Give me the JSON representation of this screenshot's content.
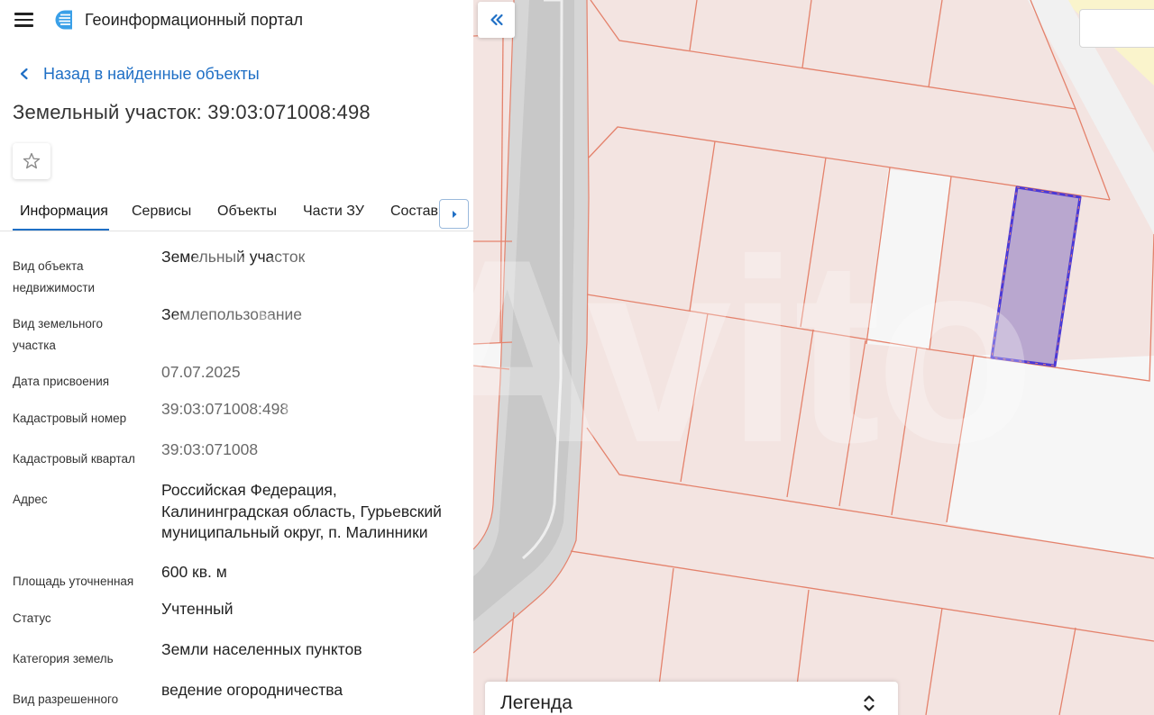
{
  "header": {
    "title": "Геоинформационный портал"
  },
  "nav": {
    "back_label": "Назад в найденные объекты"
  },
  "object": {
    "title": "Земельный участок: 39:03:071008:498"
  },
  "tabs": [
    {
      "label": "Информация",
      "active": true
    },
    {
      "label": "Сервисы"
    },
    {
      "label": "Объекты"
    },
    {
      "label": "Части ЗУ"
    },
    {
      "label": "Состав"
    }
  ],
  "info": [
    {
      "label": "Вид объекта недвижимости",
      "value": "Земельный участок"
    },
    {
      "label": "Вид земельного участка",
      "value": "Землепользование"
    },
    {
      "label": "Дата присвоения",
      "value": "07.07.2025"
    },
    {
      "label": "Кадастровый номер",
      "value": "39:03:071008:498"
    },
    {
      "label": "Кадастровый квартал",
      "value": "39:03:071008"
    },
    {
      "label": "Адрес",
      "value": "Российская Федерация, Калининградская область, Гурьевский муниципальный округ, п. Малинники"
    },
    {
      "label": "Площадь уточненная",
      "value": "600 кв. м"
    },
    {
      "label": "Статус",
      "value": "Учтенный"
    },
    {
      "label": "Категория земель",
      "value": "Земли населенных пунктов"
    },
    {
      "label": "Вид разрешенного",
      "value": "ведение огородничества"
    }
  ],
  "map": {
    "legend_title": "Легенда"
  },
  "watermark": {
    "text": "Avito"
  },
  "icons": {
    "menu": "hamburger-icon",
    "logo": "portal-logo-icon",
    "back": "chevron-left-icon",
    "favorite": "star-icon",
    "tabs_scroll": "triangle-right-icon",
    "collapse": "double-chevron-left-icon",
    "legend_toggle": "chevron-up-down-icon"
  },
  "colors": {
    "accent": "#1f6fc5",
    "parcel_fill": "#f3e4e1",
    "parcel_border": "#e4826c",
    "selected_fill": "#b9a7cf",
    "selected_border": "#4b39d6"
  }
}
